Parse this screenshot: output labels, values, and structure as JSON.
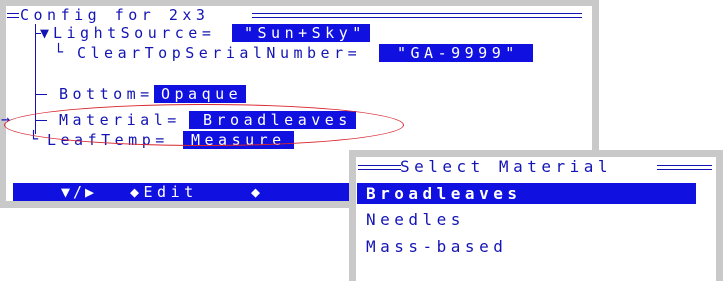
{
  "config": {
    "title": "Config for 2x3",
    "tree": [
      {
        "prefix": "▼",
        "label": "LightSource=",
        "value": "\"Sun+Sky\""
      },
      {
        "prefix": "└",
        "label": "ClearTopSerialNumber=",
        "value": "\"GA-9999\""
      },
      {
        "prefix": "",
        "label": "Bottom=",
        "value": "Opaque"
      },
      {
        "prefix": "→",
        "label": "Material=",
        "value": "Broadleaves"
      },
      {
        "prefix": "└",
        "label": "LeafTemp=",
        "value": "Measure"
      }
    ],
    "menubar": {
      "nav": "▼/▶",
      "edit": "◆Edit",
      "end": "◆"
    }
  },
  "popup": {
    "title": "Select Material",
    "options": [
      "Broadleaves",
      "Needles",
      "Mass-based"
    ],
    "selected_index": 0
  },
  "colors": {
    "accent": "#1010e0",
    "text": "#1414b4",
    "annotation": "#d8262e",
    "frame": "#c9c9c9"
  }
}
